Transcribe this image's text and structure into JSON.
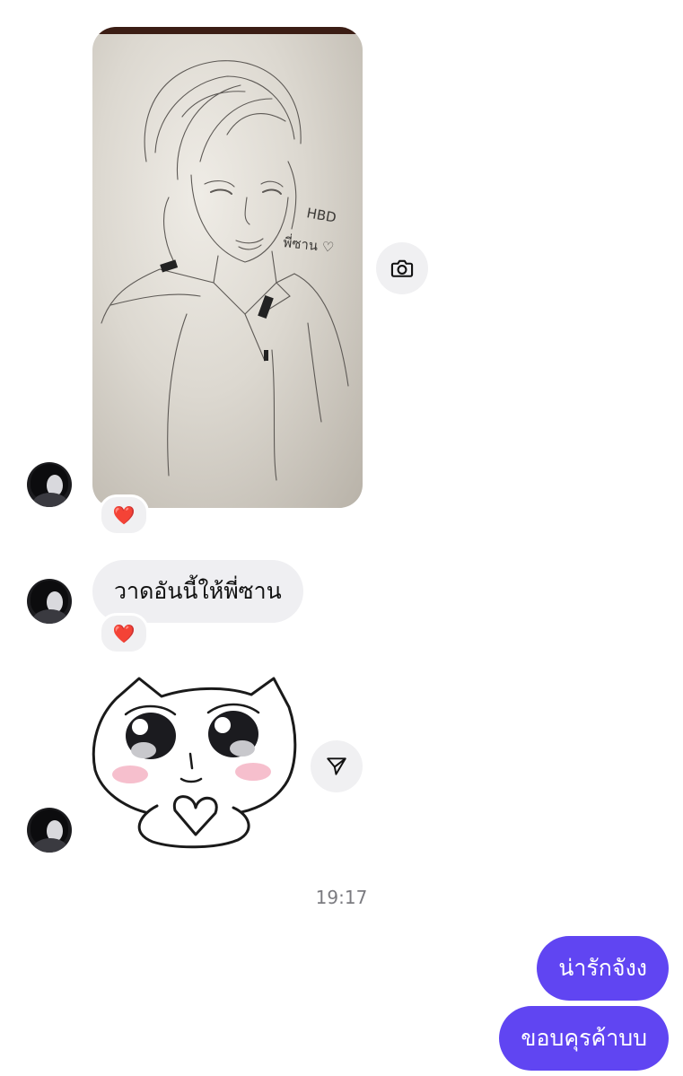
{
  "messages": {
    "drawing_reaction": "❤️",
    "text_in": "วาดอันนี้ให้พี่ซาน",
    "text_in_reaction": "❤️"
  },
  "drawing": {
    "caption_line1": "HBD",
    "caption_line2": "พี่ซาน ♡"
  },
  "timestamp": "19:17",
  "outgoing": [
    "น่ารักจังง",
    "ขอบคุรค้าบบ"
  ],
  "icons": {
    "photo_action": "camera-icon",
    "sticker_action": "send-icon"
  },
  "colors": {
    "outgoing_bubble": "#6045f2",
    "incoming_bubble": "#efeff2",
    "timestamp": "#7b7b80"
  }
}
